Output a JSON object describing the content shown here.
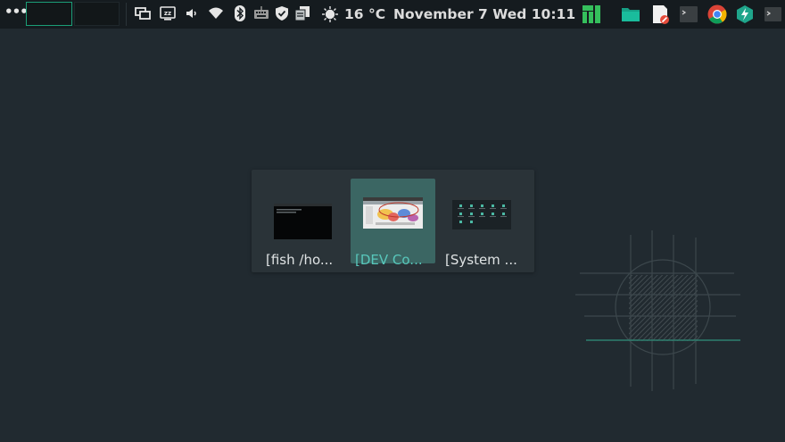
{
  "panel": {
    "menu_icon": "more-icon",
    "workspaces": [
      "workspace-1",
      "workspace-2"
    ],
    "tray_icons": [
      "screens-icon",
      "sleep-icon",
      "volume-icon",
      "wifi-icon",
      "bluetooth-icon",
      "keyboard-icon",
      "shield-icon",
      "clipboard-icon"
    ],
    "weather": {
      "icon": "sun-icon",
      "temperature": "16 °C"
    },
    "datetime": "November 7 Wed 10:11",
    "launchers": [
      "manjaro-icon",
      "folder-icon",
      "editor-icon",
      "terminal-icon",
      "chrome-icon",
      "bolt-icon",
      "terminal-small-icon"
    ]
  },
  "switcher": {
    "items": [
      {
        "label": "[fish  /ho...",
        "active": false
      },
      {
        "label": "[DEV Co...",
        "active": true
      },
      {
        "label": "[System ...",
        "active": false
      }
    ]
  },
  "colors": {
    "desktop": "#212a30",
    "panel": "#151b1f",
    "accent": "#1b9e77",
    "switcher_bg": "#2a3338",
    "active_bg": "#3b6663",
    "active_text": "#58c7bb"
  }
}
